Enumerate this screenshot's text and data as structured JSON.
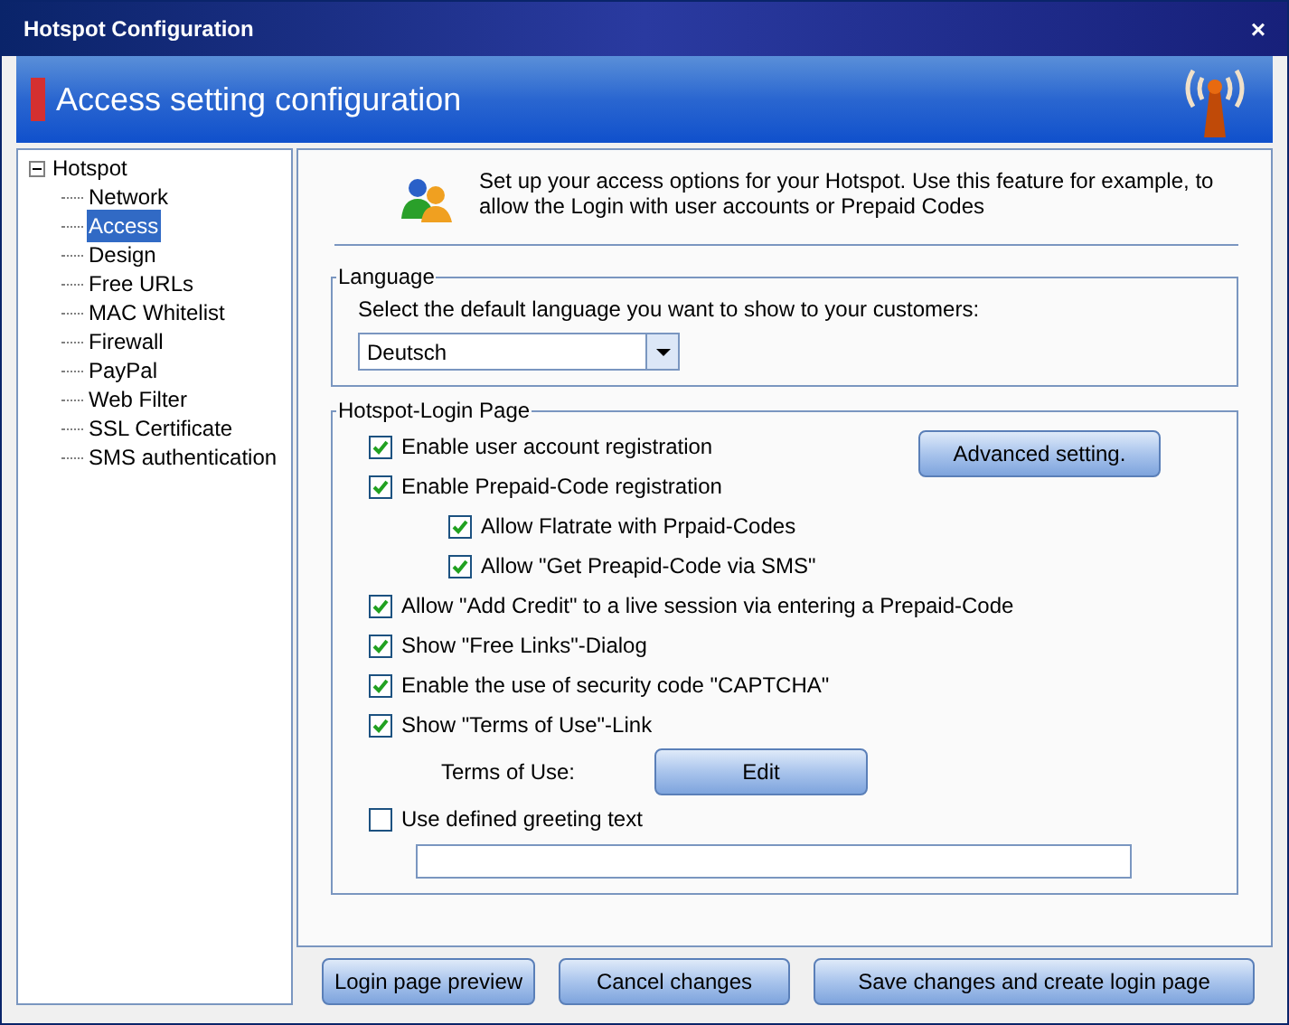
{
  "window": {
    "title": "Hotspot Configuration",
    "close": "×"
  },
  "banner": {
    "title": "Access setting configuration"
  },
  "tree": {
    "label": "Hotspot",
    "expanded": true,
    "children": [
      {
        "label": "Network",
        "selected": false
      },
      {
        "label": "Access",
        "selected": true
      },
      {
        "label": "Design",
        "selected": false
      },
      {
        "label": "Free URLs",
        "selected": false
      },
      {
        "label": "MAC Whitelist",
        "selected": false
      },
      {
        "label": "Firewall",
        "selected": false
      },
      {
        "label": "PayPal",
        "selected": false
      },
      {
        "label": "Web Filter",
        "selected": false
      },
      {
        "label": "SSL Certificate",
        "selected": false
      },
      {
        "label": "SMS authentication",
        "selected": false
      }
    ]
  },
  "intro": "Set up your access options for your Hotspot. Use this feature for example, to allow the Login with user accounts or Prepaid Codes",
  "language": {
    "legend": "Language",
    "prompt": "Select the default language you want to show to your customers:",
    "value": "Deutsch"
  },
  "login_page": {
    "legend": "Hotspot-Login Page",
    "advanced_button": "Advanced setting.",
    "options": [
      {
        "kind": "checkbox",
        "label": "Enable user account registration",
        "checked": true
      },
      {
        "kind": "checkbox",
        "label": "Enable Prepaid-Code registration",
        "checked": true,
        "children": [
          {
            "kind": "checkbox",
            "label": "Allow Flatrate with Prpaid-Codes",
            "checked": true
          },
          {
            "kind": "checkbox",
            "label": "Allow \"Get Preapid-Code via SMS\"",
            "checked": true
          }
        ]
      },
      {
        "kind": "checkbox",
        "label": "Allow \"Add Credit\" to a live session via entering a Prepaid-Code",
        "checked": true
      },
      {
        "kind": "checkbox",
        "label": "Show \"Free Links\"-Dialog",
        "checked": true
      },
      {
        "kind": "checkbox",
        "label": "Enable the use of security code \"CAPTCHA\"",
        "checked": true
      },
      {
        "kind": "checkbox",
        "label": "Show \"Terms of Use\"-Link",
        "checked": true
      },
      {
        "kind": "button-row",
        "label": "Terms of Use:",
        "button": "Edit"
      },
      {
        "kind": "checkbox",
        "label": "Use defined greeting text",
        "checked": false
      },
      {
        "kind": "text-field"
      }
    ]
  },
  "buttons": [
    "Login page preview",
    "Cancel changes",
    "Save changes and create login page"
  ]
}
